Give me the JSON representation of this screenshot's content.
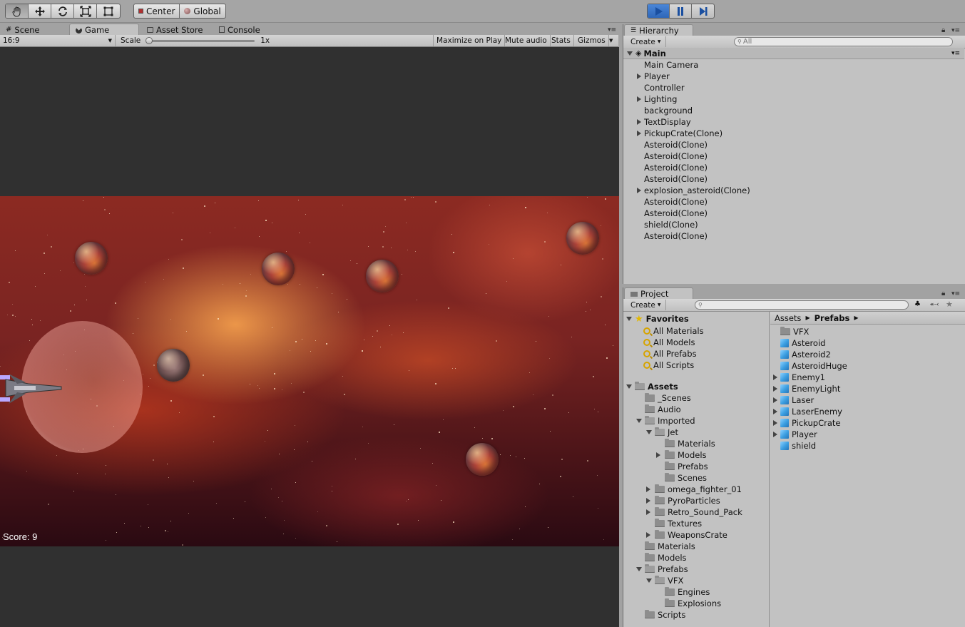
{
  "toolbar": {
    "tools": [
      "hand-tool-icon",
      "move-tool-icon",
      "rotate-tool-icon",
      "scale-tool-icon",
      "rect-tool-icon"
    ],
    "pivot_center": "Center",
    "pivot_global": "Global",
    "play": [
      "play-icon",
      "pause-icon",
      "step-icon"
    ],
    "accent": "#2f67b8"
  },
  "left_tabs": {
    "scene": "Scene",
    "game": "Game",
    "asset_store": "Asset Store",
    "console": "Console"
  },
  "game_bar": {
    "aspect": "16:9",
    "scale_label": "Scale",
    "scale_value": "1x",
    "maximize": "Maximize on Play",
    "mute": "Mute audio",
    "stats": "Stats",
    "gizmos": "Gizmos"
  },
  "game": {
    "score": "Score: 9"
  },
  "hierarchy": {
    "tab": "Hierarchy",
    "create": "Create",
    "search_placeholder": "All",
    "scene_name": "Main",
    "items": [
      {
        "label": "Main Camera",
        "expandable": false
      },
      {
        "label": "Player",
        "expandable": true
      },
      {
        "label": "Controller",
        "expandable": false
      },
      {
        "label": "Lighting",
        "expandable": true
      },
      {
        "label": "background",
        "expandable": false
      },
      {
        "label": "TextDisplay",
        "expandable": true
      },
      {
        "label": "PickupCrate(Clone)",
        "expandable": true
      },
      {
        "label": "Asteroid(Clone)",
        "expandable": false
      },
      {
        "label": "Asteroid(Clone)",
        "expandable": false
      },
      {
        "label": "Asteroid(Clone)",
        "expandable": false
      },
      {
        "label": "Asteroid(Clone)",
        "expandable": false
      },
      {
        "label": "explosion_asteroid(Clone)",
        "expandable": true
      },
      {
        "label": "Asteroid(Clone)",
        "expandable": false
      },
      {
        "label": "Asteroid(Clone)",
        "expandable": false
      },
      {
        "label": "shield(Clone)",
        "expandable": false
      },
      {
        "label": "Asteroid(Clone)",
        "expandable": false
      }
    ]
  },
  "project": {
    "tab": "Project",
    "create": "Create",
    "favorites": {
      "label": "Favorites",
      "items": [
        "All Materials",
        "All Models",
        "All Prefabs",
        "All Scripts"
      ]
    },
    "assets_label": "Assets",
    "tree": [
      {
        "label": "_Scenes",
        "depth": 1,
        "arrow": "none",
        "open": false
      },
      {
        "label": "Audio",
        "depth": 1,
        "arrow": "none",
        "open": false
      },
      {
        "label": "Imported",
        "depth": 1,
        "arrow": "down",
        "open": true
      },
      {
        "label": "Jet",
        "depth": 2,
        "arrow": "down",
        "open": true
      },
      {
        "label": "Materials",
        "depth": 3,
        "arrow": "none",
        "open": false
      },
      {
        "label": "Models",
        "depth": 3,
        "arrow": "right",
        "open": false
      },
      {
        "label": "Prefabs",
        "depth": 3,
        "arrow": "none",
        "open": false
      },
      {
        "label": "Scenes",
        "depth": 3,
        "arrow": "none",
        "open": false
      },
      {
        "label": "omega_fighter_01",
        "depth": 2,
        "arrow": "right",
        "open": false
      },
      {
        "label": "PyroParticles",
        "depth": 2,
        "arrow": "right",
        "open": false
      },
      {
        "label": "Retro_Sound_Pack",
        "depth": 2,
        "arrow": "right",
        "open": false
      },
      {
        "label": "Textures",
        "depth": 2,
        "arrow": "none",
        "open": false
      },
      {
        "label": "WeaponsCrate",
        "depth": 2,
        "arrow": "right",
        "open": false
      },
      {
        "label": "Materials",
        "depth": 1,
        "arrow": "none",
        "open": false
      },
      {
        "label": "Models",
        "depth": 1,
        "arrow": "none",
        "open": false
      },
      {
        "label": "Prefabs",
        "depth": 1,
        "arrow": "down",
        "open": true
      },
      {
        "label": "VFX",
        "depth": 2,
        "arrow": "down",
        "open": true
      },
      {
        "label": "Engines",
        "depth": 3,
        "arrow": "none",
        "open": false
      },
      {
        "label": "Explosions",
        "depth": 3,
        "arrow": "none",
        "open": false
      },
      {
        "label": "Scripts",
        "depth": 1,
        "arrow": "none",
        "open": false
      }
    ],
    "breadcrumb": {
      "root": "Assets",
      "current": "Prefabs"
    },
    "contents": [
      {
        "label": "VFX",
        "kind": "folder",
        "expandable": false
      },
      {
        "label": "Asteroid",
        "kind": "prefab",
        "expandable": false
      },
      {
        "label": "Asteroid2",
        "kind": "prefab",
        "expandable": false
      },
      {
        "label": "AsteroidHuge",
        "kind": "prefab",
        "expandable": false
      },
      {
        "label": "Enemy1",
        "kind": "prefab",
        "expandable": true
      },
      {
        "label": "EnemyLight",
        "kind": "prefab",
        "expandable": true
      },
      {
        "label": "Laser",
        "kind": "prefab",
        "expandable": true
      },
      {
        "label": "LaserEnemy",
        "kind": "prefab",
        "expandable": true
      },
      {
        "label": "PickupCrate",
        "kind": "prefab",
        "expandable": true
      },
      {
        "label": "Player",
        "kind": "prefab",
        "expandable": true
      },
      {
        "label": "shield",
        "kind": "prefab",
        "expandable": false
      }
    ]
  }
}
